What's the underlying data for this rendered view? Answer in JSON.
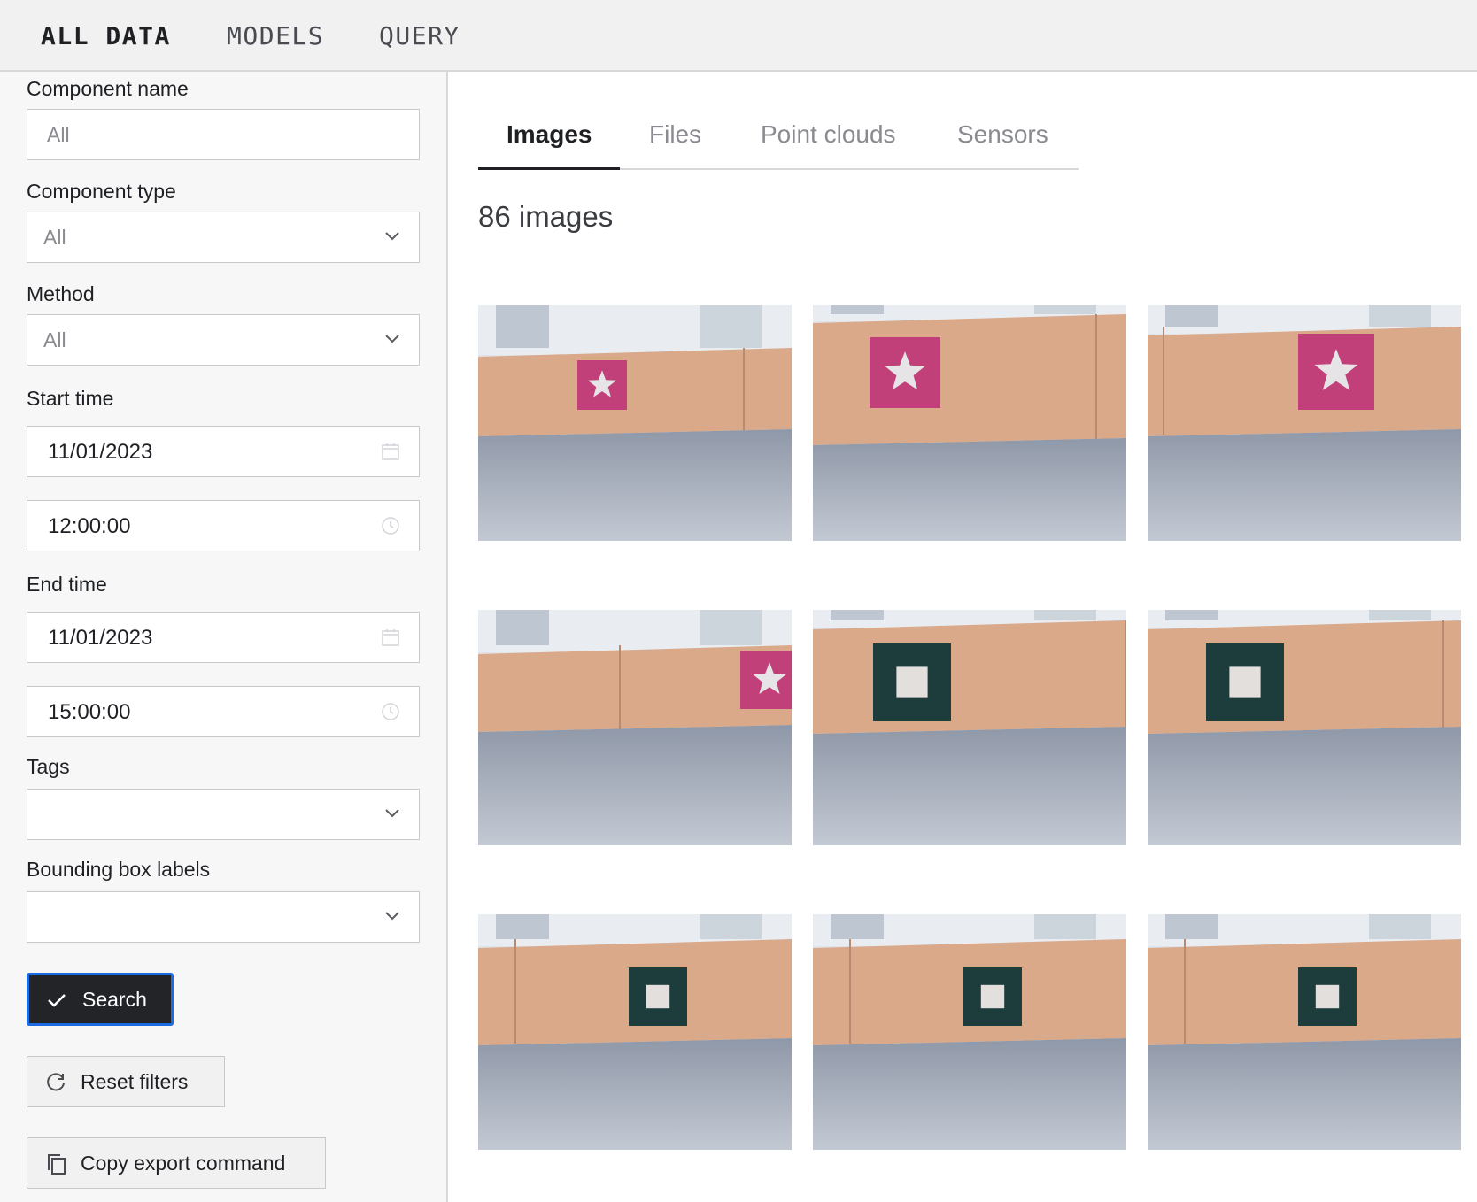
{
  "nav": {
    "items": [
      {
        "label": "ALL DATA",
        "active": true
      },
      {
        "label": "MODELS",
        "active": false
      },
      {
        "label": "QUERY",
        "active": false
      }
    ]
  },
  "filters": {
    "component_name": {
      "label": "Component name",
      "placeholder": "All"
    },
    "component_type": {
      "label": "Component type",
      "value": "All"
    },
    "method": {
      "label": "Method",
      "value": "All"
    },
    "start_time": {
      "label": "Start time",
      "date": "11/01/2023",
      "time": "12:00:00"
    },
    "end_time": {
      "label": "End time",
      "date": "11/01/2023",
      "time": "15:00:00"
    },
    "tags": {
      "label": "Tags",
      "value": ""
    },
    "bbox_labels": {
      "label": "Bounding box labels",
      "value": ""
    },
    "search_label": "Search",
    "reset_label": "Reset filters",
    "copy_label": "Copy export command"
  },
  "tabs": [
    {
      "label": "Images",
      "active": true
    },
    {
      "label": "Files",
      "active": false
    },
    {
      "label": "Point clouds",
      "active": false
    },
    {
      "label": "Sensors",
      "active": false
    }
  ],
  "results": {
    "count_text": "86 images",
    "images": [
      {
        "subject": "pink-star-sign"
      },
      {
        "subject": "pink-star-sign"
      },
      {
        "subject": "pink-star-sign"
      },
      {
        "subject": "pink-star-sign"
      },
      {
        "subject": "dark-square-sign"
      },
      {
        "subject": "dark-square-sign"
      },
      {
        "subject": "dark-square-sign"
      },
      {
        "subject": "dark-square-sign"
      },
      {
        "subject": "dark-square-sign"
      }
    ]
  },
  "colors": {
    "accent_focus": "#1d6be0",
    "primary_button": "#232428",
    "star_sign": "#c2407a",
    "square_sign": "#1d3d3c",
    "wall_wood": "#d9a98a",
    "carpet": "#aeb6c4"
  }
}
